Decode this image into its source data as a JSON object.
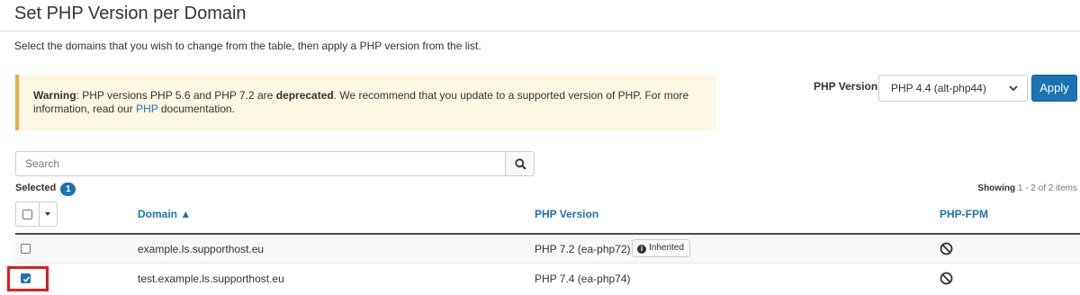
{
  "page": {
    "title": "Set PHP Version per Domain",
    "description": "Select the domains that you wish to change from the table, then apply a PHP version from the list."
  },
  "warning": {
    "label": "Warning",
    "text_1": ": PHP versions PHP 5.6 and PHP 7.2 are ",
    "emphasis": "deprecated",
    "text_2": ". We recommend that you update to a supported version of PHP. For more information, read our ",
    "link": "PHP",
    "text_3": " documentation."
  },
  "php_select": {
    "label": "PHP Version",
    "selected": "PHP 4.4 (alt-php44)",
    "apply_label": "Apply"
  },
  "search": {
    "placeholder": "Search"
  },
  "selection": {
    "label": "Selected",
    "count": "1"
  },
  "pagination": {
    "showing_label": "Showing",
    "range": "1 - 2 of 2 items"
  },
  "table": {
    "columns": {
      "domain": "Domain ▲",
      "php_version": "PHP Version",
      "php_fpm": "PHP-FPM"
    },
    "rows": [
      {
        "domain": "example.ls.supporthost.eu",
        "php_version": "PHP 7.2 (ea-php72)",
        "badge": "Inherited",
        "checked": false
      },
      {
        "domain": "test.example.ls.supporthost.eu",
        "php_version": "PHP 7.4 (ea-php74)",
        "badge": "",
        "checked": true
      }
    ]
  },
  "colors": {
    "accent": "#1a73b5",
    "warning_bg": "#fcf8e3",
    "warning_border": "#f0ad4e",
    "highlight": "#e01b22"
  },
  "icons": {
    "search": "search-icon",
    "php_fpm_disabled": "disabled-icon",
    "info": "info-icon",
    "checkbox_checked": "checkmark-icon"
  }
}
